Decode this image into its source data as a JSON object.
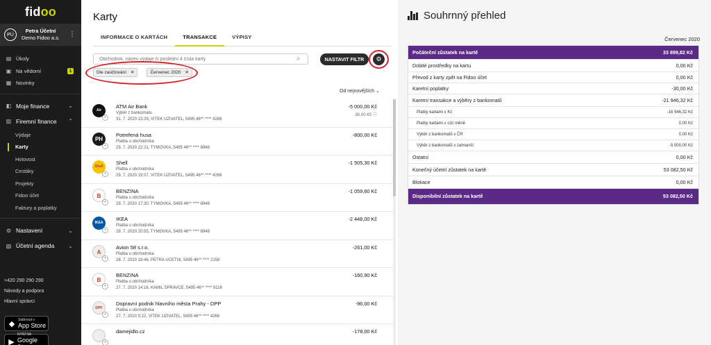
{
  "sidebar": {
    "brand": {
      "pre": "fid",
      "accent": "oo"
    },
    "user": {
      "initials": "PÚ",
      "name": "Petra Účetní",
      "company": "Demo Fidoo a.s."
    },
    "items": [
      {
        "label": "Úkoly",
        "icon": "clipboard-icon"
      },
      {
        "label": "Na vědomí",
        "icon": "inbox-icon",
        "badge": "1"
      },
      {
        "label": "Novinky",
        "icon": "newspaper-icon"
      }
    ],
    "sections": [
      {
        "label": "Moje finance",
        "icon": "wallet-icon"
      },
      {
        "label": "Firemní finance",
        "icon": "building-icon"
      }
    ],
    "subitems": [
      "Výdaje",
      "Karty",
      "Hotovost",
      "Cestáky",
      "Projekty",
      "Fidoo účet",
      "Faktury a poplatky"
    ],
    "settings": {
      "label": "Nastavení"
    },
    "accounting": {
      "label": "Účetní agenda"
    },
    "footer": {
      "phone": "+420 290 290 290",
      "help": "Návody a podpora",
      "admins": "Hlavní správci"
    },
    "stores": {
      "apple": {
        "top": "Stáhnout v",
        "name": "App Store"
      },
      "google": {
        "top": "NYNÍ NA",
        "name": "Google Play"
      }
    }
  },
  "main": {
    "title": "Karty",
    "tabs": [
      "INFORMACE O KARTÁCH",
      "TRANSAKCE",
      "VÝPISY"
    ],
    "search_placeholder": "Obchodník, název výdaje či poslední 4 čísla karty",
    "filter_button": "NASTAVIT FILTR",
    "chips": [
      "Dle zaúčtování",
      "Červenec 2020"
    ],
    "sort": "Od nejnovějších",
    "transactions": [
      {
        "name": "ATM Air Bank",
        "type": "Výběr z bankomatu",
        "meta": "31. 7. 2020 13:29, VITEK UZIVATEL, 5495 46** **** 4266",
        "amount": "-5 000,00 Kč",
        "amount2": "-30,00 Kč ⓘ",
        "logo_color": "#111111",
        "logo_text": "Air Bank"
      },
      {
        "name": "Potrefená husa",
        "type": "Platba u obchodníka",
        "meta": "29. 7. 2020 22:21, TYMOVKA, 5495 46** **** 6948",
        "amount": "-800,00 Kč",
        "amount2": "",
        "logo_color": "#1a1a1a",
        "logo_text": "PH"
      },
      {
        "name": "Shell",
        "type": "Platba u obchodníka",
        "meta": "29. 7. 2020 19:37, VITEK UZIVATEL, 5495 46** **** 4266",
        "amount": "-1 505,30 Kč",
        "amount2": "",
        "logo_color": "#f5c400",
        "logo_text": "Shell"
      },
      {
        "name": "BENZINA",
        "type": "Platba u obchodníka",
        "meta": "29. 7. 2020 17:30, TYMOVKA, 5495 46** **** 6948",
        "amount": "-1 059,60 Kč",
        "amount2": "",
        "logo_color": "#ffffff",
        "logo_text": "B"
      },
      {
        "name": "IKEA",
        "type": "Platba u obchodníka",
        "meta": "29. 7. 2020 20:55, TYMOVKA, 5495 46** **** 6948",
        "amount": "-2 448,00 Kč",
        "amount2": "",
        "logo_color": "#0058a3",
        "logo_text": "IKEA"
      },
      {
        "name": "Avion 58 s.r.o.",
        "type": "Platba u obchodníka",
        "meta": "28. 7. 2020 18:46, PETRA UCETNI, 5495 46** **** 2158",
        "amount": "-261,00 Kč",
        "amount2": "",
        "logo_color": "#eeeeee",
        "logo_text": "A"
      },
      {
        "name": "BENZINA",
        "type": "Platba u obchodníka",
        "meta": "27. 7. 2020 14:16, KAMIL SPRAVCE, 5495 46** **** 9116",
        "amount": "-160,90 Kč",
        "amount2": "",
        "logo_color": "#ffffff",
        "logo_text": "B"
      },
      {
        "name": "Dopravní podnik hlavního města Prahy - DPP",
        "type": "Platba u obchodníka",
        "meta": "27. 7. 2020 5:22, VITEK UZIVATEL, 5495 46** **** 4266",
        "amount": "-96,00 Kč",
        "amount2": "",
        "logo_color": "#eeeeee",
        "logo_text": "DPP"
      },
      {
        "name": "damejidlo.cz",
        "type": "",
        "meta": "",
        "amount": "-178,00 Kč",
        "amount2": "",
        "logo_color": "#eeeeee",
        "logo_text": ""
      }
    ]
  },
  "summary": {
    "title": "Souhrnný přehled",
    "period": "Červenec 2020",
    "head": {
      "label": "Počáteční zůstatek na kartě",
      "value": "33 899,82 Kč"
    },
    "rows": [
      {
        "label": "Dobité prostředky na kartu",
        "value": "0,00 Kč",
        "sub": false
      },
      {
        "label": "Převod z karty zpět na Fidoo účet",
        "value": "0,00 Kč",
        "sub": false
      },
      {
        "label": "Karetní poplatky",
        "value": "-30,00 Kč",
        "sub": false
      },
      {
        "label": "Karetní transakce a výběry z bankomatů",
        "value": "-21 946,32 Kč",
        "sub": false
      },
      {
        "label": "Platby kartami v Kč",
        "value": "-16 946,32 Kč",
        "sub": true
      },
      {
        "label": "Platby kartami v cizí měně",
        "value": "0,00 Kč",
        "sub": true
      },
      {
        "label": "Výběr z bankomatů v ČR",
        "value": "0,00 Kč",
        "sub": true
      },
      {
        "label": "Výběr z bankomatů v zahraničí",
        "value": "-5 000,00 Kč",
        "sub": true
      },
      {
        "label": "Ostatní",
        "value": "0,00 Kč",
        "sub": false
      },
      {
        "label": "Konečný účetní zůstatek na kartě",
        "value": "53 082,50 Kč",
        "sub": false
      },
      {
        "label": "Blokace",
        "value": "0,00 Kč",
        "sub": false
      }
    ],
    "foot": {
      "label": "Disponibilní zůstatek na kartě",
      "value": "53 082,50 Kč"
    }
  },
  "colors": {
    "accent": "#c8d400",
    "purple": "#5b2a86",
    "annotation": "#d61f26"
  }
}
